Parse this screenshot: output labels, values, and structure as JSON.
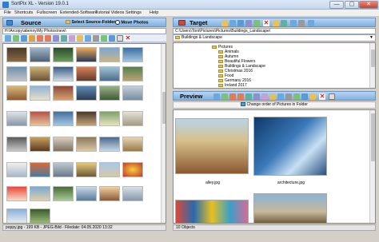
{
  "window": {
    "title": "SortPix XL - Version 19.0.1",
    "min": "—",
    "max": "▢",
    "close": "✕"
  },
  "menu": [
    "File",
    "Shortcuts",
    "Fullscreen",
    "Extended-Software",
    "Tutorial Videos",
    "Settings",
    "Help"
  ],
  "source": {
    "title": "Source",
    "select_folder": "Select Source-Folder",
    "move_photos": "Move Photos",
    "path": "H:\\Arcopy\\abenny\\My Photos\\new\\",
    "status": "poppy.jpg - 199 KB - JPEG-Bild - Filedate: 04.05.2020 13:32"
  },
  "target": {
    "title": "Target",
    "path": "C:\\Users\\Toni\\Pictures\\Pictures\\Buildings_Landscape\\",
    "current": "Buildings & Landscape",
    "tree": [
      {
        "label": "Pictures",
        "indent": 0
      },
      {
        "label": "Animals",
        "indent": 1
      },
      {
        "label": "Autumn",
        "indent": 1
      },
      {
        "label": "Beautiful Flowers",
        "indent": 1
      },
      {
        "label": "Buildings & Landscape",
        "indent": 1
      },
      {
        "label": "Christmas 2016",
        "indent": 1
      },
      {
        "label": "Food",
        "indent": 1
      },
      {
        "label": "Germany 2016",
        "indent": 1
      },
      {
        "label": "Ireland 2017",
        "indent": 1
      }
    ]
  },
  "preview": {
    "title": "Preview",
    "change_order": "Change order of Pictures in Folder",
    "items": [
      {
        "label": "alley.jpg"
      },
      {
        "label": "architecture.jpg"
      }
    ],
    "status": "10 Objects"
  }
}
